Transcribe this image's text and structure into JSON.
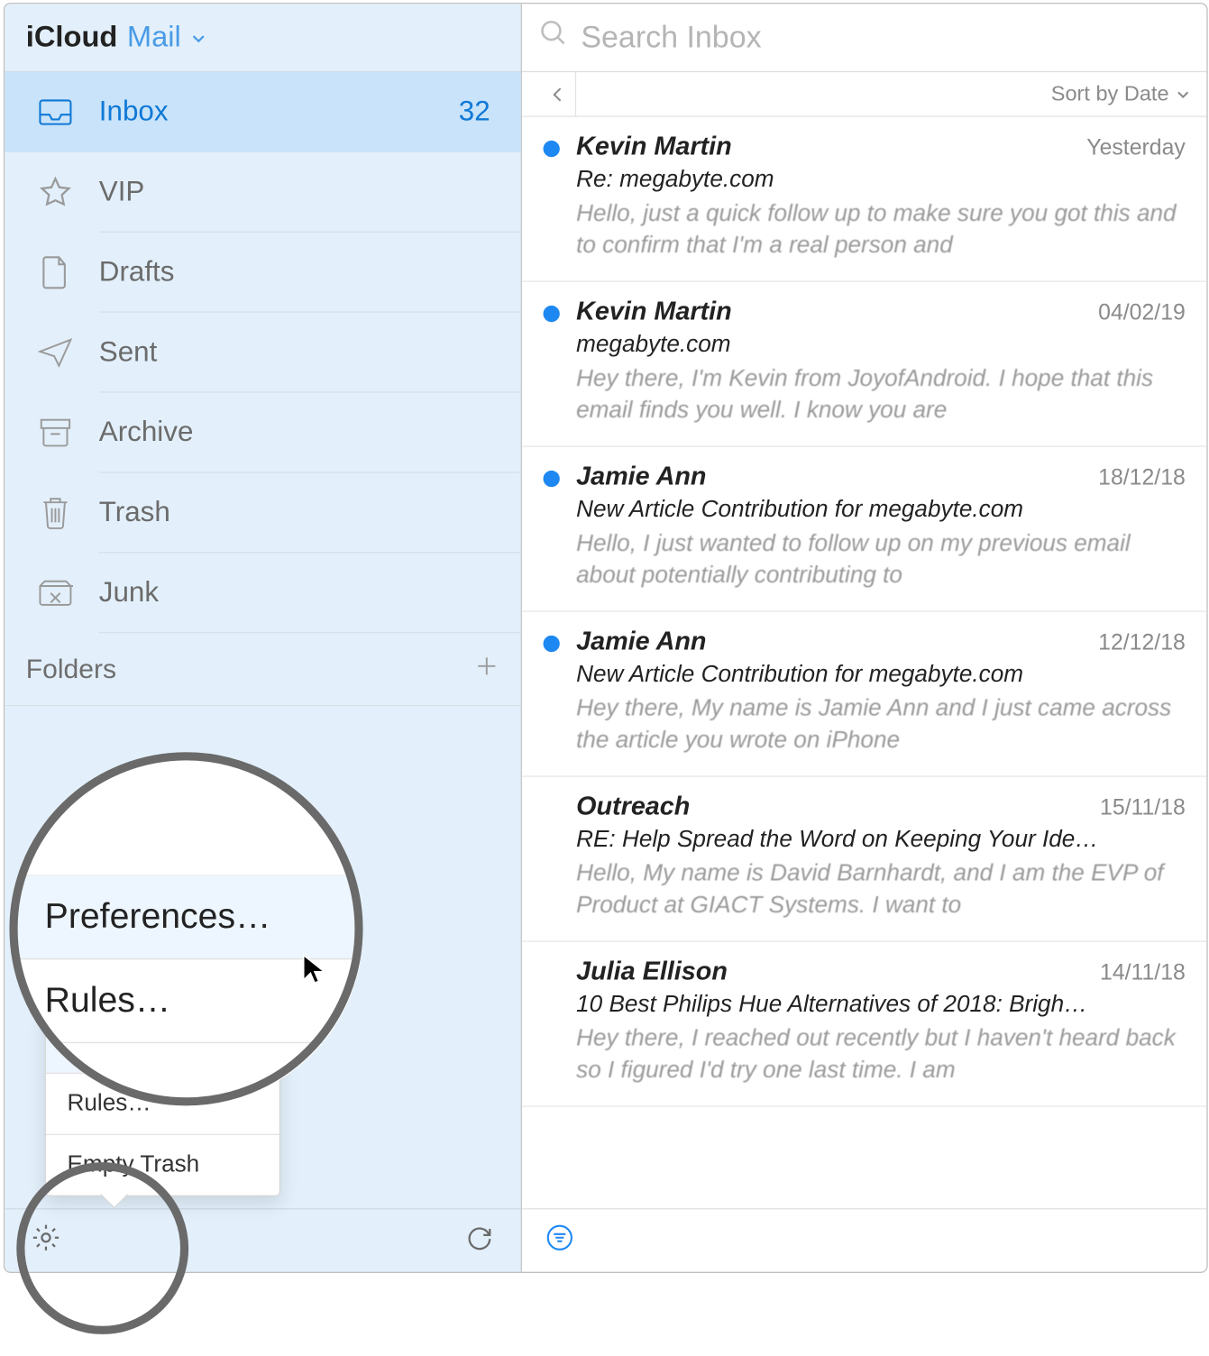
{
  "header": {
    "brand": "iCloud",
    "mail": "Mail"
  },
  "sidebar": {
    "items": [
      {
        "label": "Inbox",
        "count": "32",
        "selected": true
      },
      {
        "label": "VIP"
      },
      {
        "label": "Drafts"
      },
      {
        "label": "Sent"
      },
      {
        "label": "Archive"
      },
      {
        "label": "Trash"
      },
      {
        "label": "Junk"
      }
    ],
    "folders_label": "Folders"
  },
  "search": {
    "placeholder": "Search Inbox"
  },
  "sort": {
    "label": "Sort by Date"
  },
  "popup": {
    "preferences": "Preferences…",
    "rules": "Rules…",
    "empty_trash": "Empty Trash"
  },
  "messages": [
    {
      "unread": true,
      "sender": "Kevin Martin",
      "date": "Yesterday",
      "subject": "Re: megabyte.com",
      "preview": "Hello, just a quick follow up to make sure you got this and to confirm that I'm a real person and"
    },
    {
      "unread": true,
      "sender": "Kevin Martin",
      "date": "04/02/19",
      "subject": "megabyte.com",
      "preview": "Hey there, I'm Kevin from JoyofAndroid. I hope that this email finds you well. I know you are"
    },
    {
      "unread": true,
      "sender": "Jamie Ann",
      "date": "18/12/18",
      "subject": "New Article Contribution for megabyte.com",
      "preview": "Hello, I just wanted to follow up on my previous email about potentially contributing to"
    },
    {
      "unread": true,
      "sender": "Jamie Ann",
      "date": "12/12/18",
      "subject": "New Article Contribution for megabyte.com",
      "preview": "Hey there, My name is Jamie Ann and I just came across the article you wrote on iPhone"
    },
    {
      "unread": false,
      "sender": "Outreach",
      "date": "15/11/18",
      "subject": "RE: Help Spread the Word on Keeping Your Ide…",
      "preview": "Hello, My name is David Barnhardt, and I am the EVP of Product at GIACT Systems. I want to"
    },
    {
      "unread": false,
      "sender": "Julia Ellison",
      "date": "14/11/18",
      "subject": "10 Best Philips Hue Alternatives of 2018: Brigh…",
      "preview": "Hey there, I reached out recently but I haven't heard back so I figured I'd try one last time. I am"
    }
  ]
}
